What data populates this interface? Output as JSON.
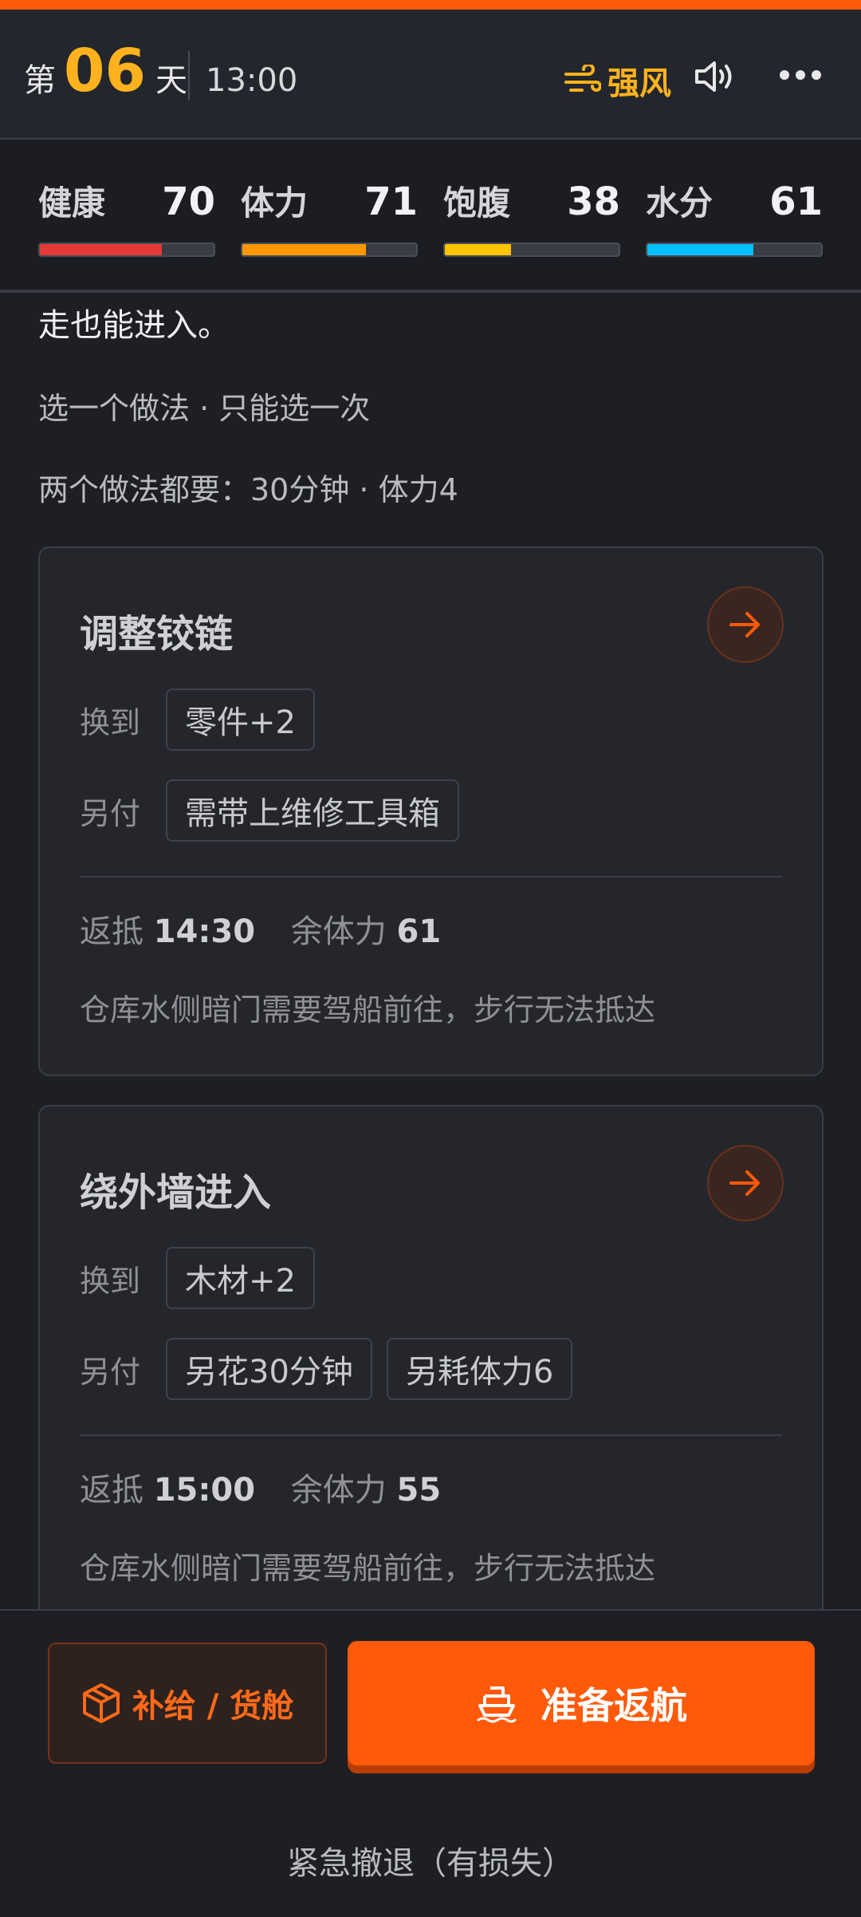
{
  "header": {
    "day_prefix": "第",
    "day_number": "06",
    "day_suffix": "天",
    "time": "13:00",
    "weather": "强风",
    "weather_icon": "wind-icon",
    "colors": {
      "accent": "#ffb21e",
      "brand": "#ff5a0a"
    }
  },
  "stats": [
    {
      "label": "健康",
      "value": "70",
      "level": 0.7,
      "color": "#e53935"
    },
    {
      "label": "体力",
      "value": "71",
      "level": 0.71,
      "color": "#ff9800"
    },
    {
      "label": "饱腹",
      "value": "38",
      "level": 0.38,
      "color": "#ffc400"
    },
    {
      "label": "水分",
      "value": "61",
      "level": 0.61,
      "color": "#00bfff"
    }
  ],
  "intro": {
    "lead": "走也能进入。",
    "hint_select": "选一个做法 · 只能选一次",
    "hint_cost": "两个做法都要：30分钟 · 体力4"
  },
  "options": [
    {
      "title": "调整铰链",
      "gain_label": "换到",
      "gain_chip": "零件+2",
      "cost_label": "另付",
      "cost_chips": [
        "需带上维修工具箱"
      ],
      "return_label": "返抵",
      "return_time": "14:30",
      "stamina_label": "余体力",
      "stamina_value": "61",
      "note": "仓库水侧暗门需要驾船前往，步行无法抵达"
    },
    {
      "title": "绕外墙进入",
      "gain_label": "换到",
      "gain_chip": "木材+2",
      "cost_label": "另付",
      "cost_chips": [
        "另花30分钟",
        "另耗体力6"
      ],
      "return_label": "返抵",
      "return_time": "15:00",
      "stamina_label": "余体力",
      "stamina_value": "55",
      "note": "仓库水侧暗门需要驾船前往，步行无法抵达"
    }
  ],
  "bottom": {
    "supply_label": "补给 / 货舱",
    "depart_label": "准备返航",
    "retreat_label": "紧急撤退（有损失）"
  }
}
